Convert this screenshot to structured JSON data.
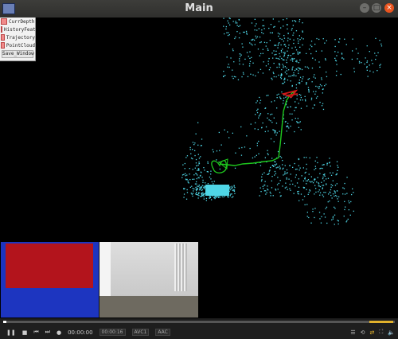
{
  "window": {
    "title": "Main"
  },
  "panel": {
    "checkboxes": [
      "CurrDepth",
      "HistoryFeat",
      "Trajectory",
      "PointCloud"
    ],
    "save_button": "Save_Window"
  },
  "player": {
    "time": "00:00:00",
    "duration": "00:00:16",
    "tags": [
      "00:00:16",
      "AVC1",
      "AAC"
    ]
  },
  "colors": {
    "points": "#4fd6e6",
    "trajectory": "#1ec81e",
    "camera": "#d01818"
  }
}
